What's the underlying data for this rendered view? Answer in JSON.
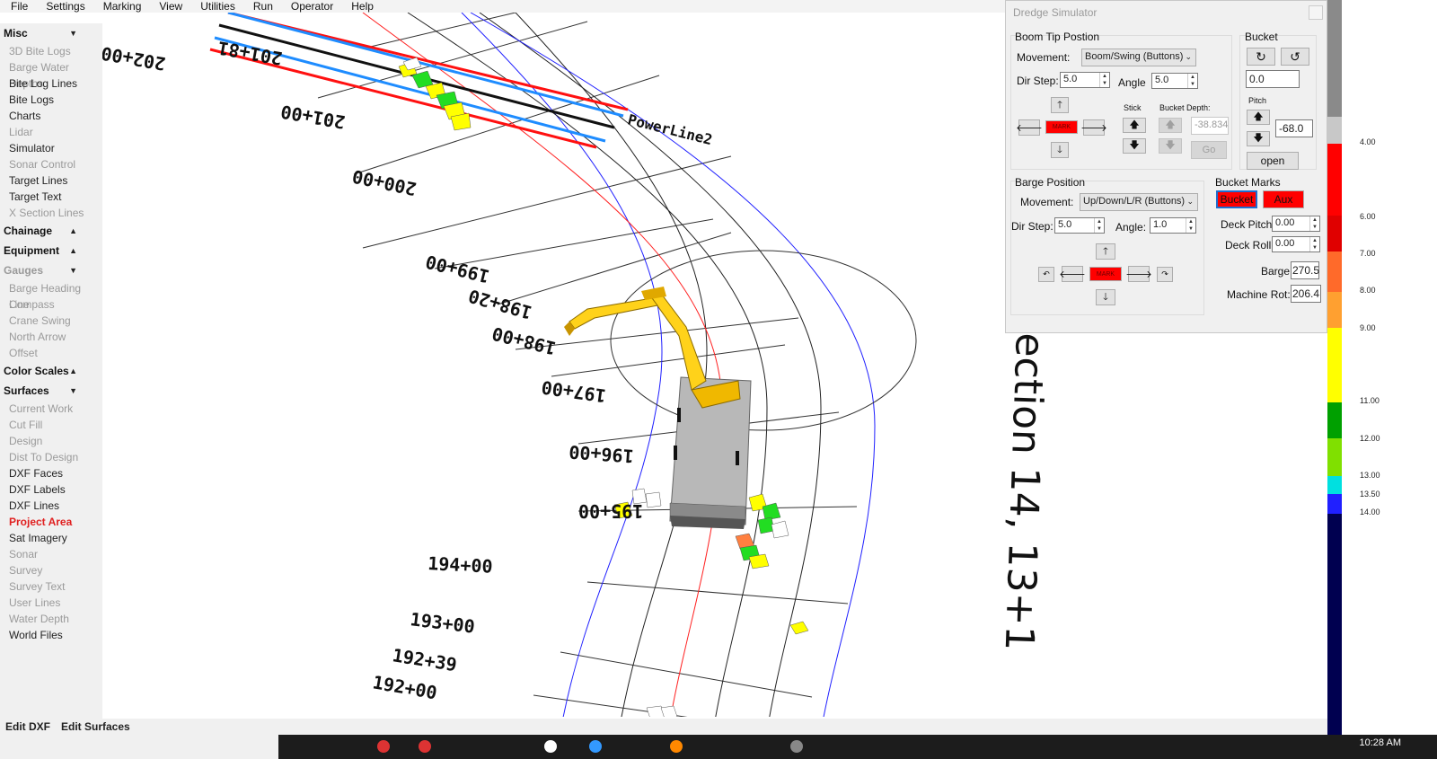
{
  "menu": [
    "File",
    "Settings",
    "Marking",
    "View",
    "Utilities",
    "Run",
    "Operator",
    "Help"
  ],
  "sidebar": {
    "misc": {
      "label": "Misc",
      "items": [
        "3D Bite Logs",
        "Barge Water Depths",
        "Bite Log Lines",
        "Bite Logs",
        "Charts",
        "Lidar",
        "Simulator",
        "Sonar Control",
        "Target Lines",
        "Target Text",
        "X Section Lines"
      ],
      "disabled": [
        0,
        1,
        5,
        7,
        10
      ]
    },
    "chainage": {
      "label": "Chainage"
    },
    "equipment": {
      "label": "Equipment"
    },
    "gauges": {
      "label": "Gauges",
      "items": [
        "Barge Heading Line",
        "Compass",
        "Crane Swing",
        "North Arrow",
        "Offset"
      ]
    },
    "color_scales": {
      "label": "Color Scales"
    },
    "surfaces": {
      "label": "Surfaces",
      "items": [
        "Current Work",
        "Cut Fill",
        "Design",
        "Dist To Design",
        "DXF Faces",
        "DXF Labels",
        "DXF Lines",
        "Project Area",
        "Sat Imagery",
        "Sonar",
        "Survey",
        "Survey Text",
        "User Lines",
        "Water Depth",
        "World Files"
      ],
      "disabled": [
        0,
        1,
        2,
        3,
        9,
        10,
        11,
        12,
        13
      ],
      "active": 7
    }
  },
  "viewport": {
    "stations": [
      "202+00",
      "201+81",
      "201+00",
      "200+00",
      "199+00",
      "198+20",
      "198+00",
      "197+00",
      "196+00",
      "195+00",
      "194+00",
      "193+00",
      "192+39",
      "192+00"
    ],
    "powerline_label": "PowerLine2",
    "section_label": "ection 14, 13+1"
  },
  "dialog": {
    "title": "Dredge Simulator",
    "boom": {
      "title": "Boom Tip Postion",
      "movement_label": "Movement:",
      "movement_value": "Boom/Swing (Buttons)",
      "dir_step_label": "Dir Step:",
      "dir_step": "5.0",
      "angle_label": "Angle",
      "angle": "5.0",
      "mark": "MARK",
      "stick_label": "Stick",
      "bucket_depth_label": "Bucket Depth:",
      "bucket_depth": "-38.834",
      "go": "Go"
    },
    "bucket": {
      "title": "Bucket",
      "value": "0.0",
      "pitch_label": "Pitch",
      "pitch": "-68.0",
      "open": "open"
    },
    "barge": {
      "title": "Barge Position",
      "movement_label": "Movement:",
      "movement_value": "Up/Down/L/R (Buttons)",
      "dir_step_label": "Dir Step:",
      "dir_step": "5.0",
      "angle_label": "Angle:",
      "angle": "1.0",
      "mark": "MARK"
    },
    "marks": {
      "title": "Bucket Marks",
      "bucket": "Bucket",
      "aux": "Aux",
      "deck_pitch_label": "Deck Pitch:",
      "deck_pitch": "0.00",
      "deck_roll_label": "Deck Roll:",
      "deck_roll": "0.00",
      "barge_label": "Barge",
      "barge": "270.5",
      "machine_rot_label": "Machine Rot:",
      "machine_rot": "206.4"
    }
  },
  "scale": {
    "labels": [
      "4.00",
      "6.00",
      "7.00",
      "8.00",
      "9.00",
      "11.00",
      "12.00",
      "13.00",
      "13.50",
      "14.00"
    ],
    "colors": [
      "#8a8a8a",
      "#c8c8c8",
      "#ff0000",
      "#e00000",
      "#ff6a2a",
      "#ffa030",
      "#ffff00",
      "#00a000",
      "#80e000",
      "#00e0e0",
      "#2020ff",
      "#000050"
    ]
  },
  "bottombar": {
    "edit_dxf": "Edit DXF",
    "edit_surfaces": "Edit Surfaces"
  },
  "taskbar": {
    "clock": "10:28 AM"
  }
}
